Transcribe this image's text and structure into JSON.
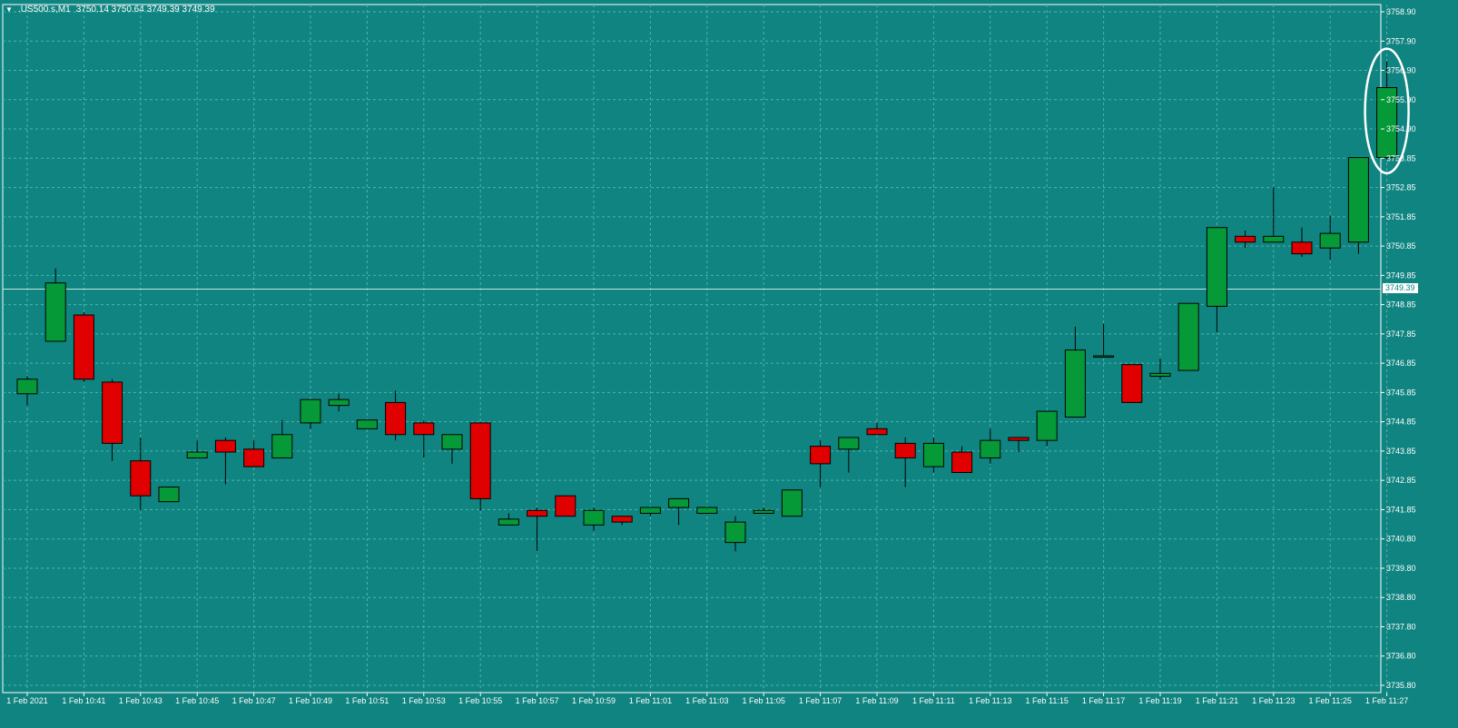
{
  "header": {
    "menu_icon": "triangle-down-icon",
    "symbol": ".US500.s,M1",
    "ohlc": "3750.14 3750.64 3749.39 3749.39"
  },
  "colors": {
    "background": "#0f8480",
    "grid": "#4fb3ae",
    "bull": "#069938",
    "bear": "#e00000",
    "axis_text": "#ffffff",
    "highlight_circle": "#ffffff"
  },
  "chart_data": {
    "type": "candlestick",
    "title": "",
    "xlabel": "",
    "ylabel": "",
    "ylim": [
      3735.8,
      3758.9
    ],
    "y_ticks": [
      "3758.90",
      "3757.90",
      "3756.90",
      "3755.90",
      "3754.90",
      "3753.85",
      "3752.85",
      "3751.85",
      "3750.85",
      "3749.85",
      "3748.85",
      "3747.85",
      "3746.85",
      "3745.85",
      "3744.85",
      "3743.85",
      "3742.85",
      "3741.85",
      "3740.80",
      "3739.80",
      "3738.80",
      "3737.80",
      "3736.80",
      "3735.80"
    ],
    "x_ticks": [
      "1 Feb 2021",
      "1 Feb 10:41",
      "1 Feb 10:43",
      "1 Feb 10:45",
      "1 Feb 10:47",
      "1 Feb 10:49",
      "1 Feb 10:51",
      "1 Feb 10:53",
      "1 Feb 10:55",
      "1 Feb 10:57",
      "1 Feb 10:59",
      "1 Feb 11:01",
      "1 Feb 11:03",
      "1 Feb 11:05",
      "1 Feb 11:07",
      "1 Feb 11:09",
      "1 Feb 11:11",
      "1 Feb 11:13",
      "1 Feb 11:15",
      "1 Feb 11:17",
      "1 Feb 11:19",
      "1 Feb 11:21",
      "1 Feb 11:23",
      "1 Feb 11:25",
      "1 Feb 11:27"
    ],
    "current_price": "3749.39",
    "grid": true,
    "annotation": "white circle around the last candle",
    "candles": [
      {
        "o": 3745.8,
        "h": 3746.4,
        "l": 3745.4,
        "c": 3746.3
      },
      {
        "o": 3747.6,
        "h": 3750.1,
        "l": 3747.6,
        "c": 3749.6
      },
      {
        "o": 3748.5,
        "h": 3748.6,
        "l": 3746.2,
        "c": 3746.3
      },
      {
        "o": 3746.2,
        "h": 3746.3,
        "l": 3743.5,
        "c": 3744.1
      },
      {
        "o": 3743.5,
        "h": 3744.3,
        "l": 3741.8,
        "c": 3742.3
      },
      {
        "o": 3742.1,
        "h": 3742.6,
        "l": 3742.1,
        "c": 3742.6
      },
      {
        "o": 3743.6,
        "h": 3744.2,
        "l": 3743.6,
        "c": 3743.8
      },
      {
        "o": 3744.2,
        "h": 3744.3,
        "l": 3742.7,
        "c": 3743.8
      },
      {
        "o": 3743.9,
        "h": 3744.2,
        "l": 3743.3,
        "c": 3743.3
      },
      {
        "o": 3743.6,
        "h": 3744.9,
        "l": 3743.6,
        "c": 3744.4
      },
      {
        "o": 3744.8,
        "h": 3745.6,
        "l": 3744.6,
        "c": 3745.6
      },
      {
        "o": 3745.4,
        "h": 3745.8,
        "l": 3745.2,
        "c": 3745.6
      },
      {
        "o": 3744.6,
        "h": 3744.9,
        "l": 3744.6,
        "c": 3744.9
      },
      {
        "o": 3745.5,
        "h": 3745.9,
        "l": 3744.2,
        "c": 3744.4
      },
      {
        "o": 3744.8,
        "h": 3744.9,
        "l": 3743.6,
        "c": 3744.4
      },
      {
        "o": 3743.9,
        "h": 3744.4,
        "l": 3743.4,
        "c": 3744.4
      },
      {
        "o": 3744.8,
        "h": 3744.8,
        "l": 3741.8,
        "c": 3742.2
      },
      {
        "o": 3741.3,
        "h": 3741.7,
        "l": 3741.3,
        "c": 3741.5
      },
      {
        "o": 3741.8,
        "h": 3741.9,
        "l": 3740.4,
        "c": 3741.6
      },
      {
        "o": 3742.3,
        "h": 3742.3,
        "l": 3741.6,
        "c": 3741.6
      },
      {
        "o": 3741.3,
        "h": 3741.9,
        "l": 3741.1,
        "c": 3741.8
      },
      {
        "o": 3741.6,
        "h": 3741.6,
        "l": 3741.3,
        "c": 3741.4
      },
      {
        "o": 3741.7,
        "h": 3741.9,
        "l": 3741.6,
        "c": 3741.9
      },
      {
        "o": 3741.9,
        "h": 3742.2,
        "l": 3741.3,
        "c": 3742.2
      },
      {
        "o": 3741.7,
        "h": 3741.9,
        "l": 3741.7,
        "c": 3741.9
      },
      {
        "o": 3740.7,
        "h": 3741.6,
        "l": 3740.4,
        "c": 3741.4
      },
      {
        "o": 3741.7,
        "h": 3741.9,
        "l": 3741.7,
        "c": 3741.8
      },
      {
        "o": 3741.6,
        "h": 3742.5,
        "l": 3741.6,
        "c": 3742.5
      },
      {
        "o": 3744.0,
        "h": 3744.2,
        "l": 3742.6,
        "c": 3743.4
      },
      {
        "o": 3743.9,
        "h": 3744.2,
        "l": 3743.1,
        "c": 3744.3
      },
      {
        "o": 3744.6,
        "h": 3744.8,
        "l": 3744.4,
        "c": 3744.4
      },
      {
        "o": 3744.1,
        "h": 3744.3,
        "l": 3742.6,
        "c": 3743.6
      },
      {
        "o": 3743.3,
        "h": 3744.3,
        "l": 3743.1,
        "c": 3744.1
      },
      {
        "o": 3743.8,
        "h": 3744.0,
        "l": 3743.1,
        "c": 3743.1
      },
      {
        "o": 3743.6,
        "h": 3744.6,
        "l": 3743.4,
        "c": 3744.2
      },
      {
        "o": 3744.3,
        "h": 3744.3,
        "l": 3743.8,
        "c": 3744.2
      },
      {
        "o": 3744.2,
        "h": 3745.2,
        "l": 3744.0,
        "c": 3745.2
      },
      {
        "o": 3745.0,
        "h": 3748.1,
        "l": 3745.0,
        "c": 3747.3
      },
      {
        "o": 3747.1,
        "h": 3748.2,
        "l": 3747.1,
        "c": 3747.1
      },
      {
        "o": 3746.8,
        "h": 3746.8,
        "l": 3745.5,
        "c": 3745.5
      },
      {
        "o": 3746.4,
        "h": 3747.0,
        "l": 3746.3,
        "c": 3746.5
      },
      {
        "o": 3746.6,
        "h": 3748.9,
        "l": 3746.6,
        "c": 3748.9
      },
      {
        "o": 3748.8,
        "h": 3751.5,
        "l": 3747.9,
        "c": 3751.5
      },
      {
        "o": 3751.2,
        "h": 3751.4,
        "l": 3750.8,
        "c": 3751.0
      },
      {
        "o": 3751.0,
        "h": 3752.9,
        "l": 3751.0,
        "c": 3751.2
      },
      {
        "o": 3751.0,
        "h": 3751.5,
        "l": 3750.5,
        "c": 3750.6
      },
      {
        "o": 3750.8,
        "h": 3751.9,
        "l": 3750.4,
        "c": 3751.3
      },
      {
        "o": 3751.0,
        "h": 3753.9,
        "l": 3750.6,
        "c": 3753.9
      },
      {
        "o": 3753.9,
        "h": 3757.2,
        "l": 3753.8,
        "c": 3756.3
      }
    ]
  }
}
